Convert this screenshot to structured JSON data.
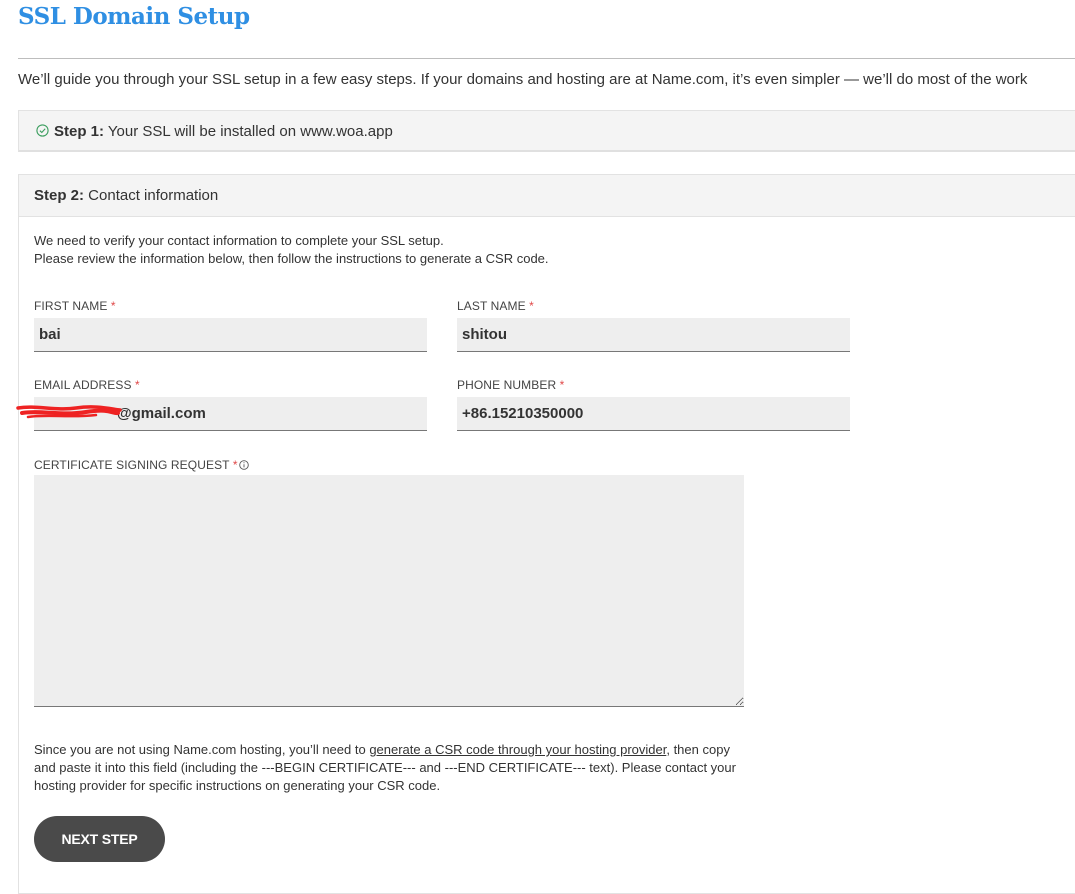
{
  "page": {
    "title": "SSL Domain Setup",
    "intro": "We’ll guide you through your SSL setup in a few easy steps. If your domains and hosting are at Name.com, it’s even simpler — we’ll do most of the work"
  },
  "step1": {
    "label": "Step 1:",
    "text": " Your SSL will be installed on www.woa.app",
    "icon": "check-circle-icon",
    "icon_color": "#3a9d5d"
  },
  "step2": {
    "label": "Step 2:",
    "text": " Contact information",
    "instructions_line1": "We need to verify your contact information to complete your SSL setup.",
    "instructions_line2": "Please review the information below, then follow the instructions to generate a CSR code.",
    "fields": {
      "first_name": {
        "label": "FIRST NAME",
        "value": "bai"
      },
      "last_name": {
        "label": "LAST NAME",
        "value": "shitou"
      },
      "email": {
        "label": "EMAIL ADDRESS",
        "value": "@gmail.com"
      },
      "phone": {
        "label": "PHONE NUMBER",
        "value": "+86.15210350000"
      },
      "csr": {
        "label": "CERTIFICATE SIGNING REQUEST",
        "value": ""
      }
    },
    "required_marker": "*",
    "help": {
      "before_link": "Since you are not using Name.com hosting, you’ll need to ",
      "link_text": "generate a CSR code through your hosting provider",
      "after_link": ", then copy and paste it into this field (including the ---BEGIN CERTIFICATE--- and ---END CERTIFICATE--- text). Please contact your hosting provider for specific instructions on generating your CSR code."
    },
    "next_button": "NEXT STEP"
  },
  "colors": {
    "title": "#2f8fe3",
    "button": "#4a4a4a",
    "required": "#e04848",
    "field_bg": "#eeeeee",
    "redaction": "#ee2222"
  }
}
